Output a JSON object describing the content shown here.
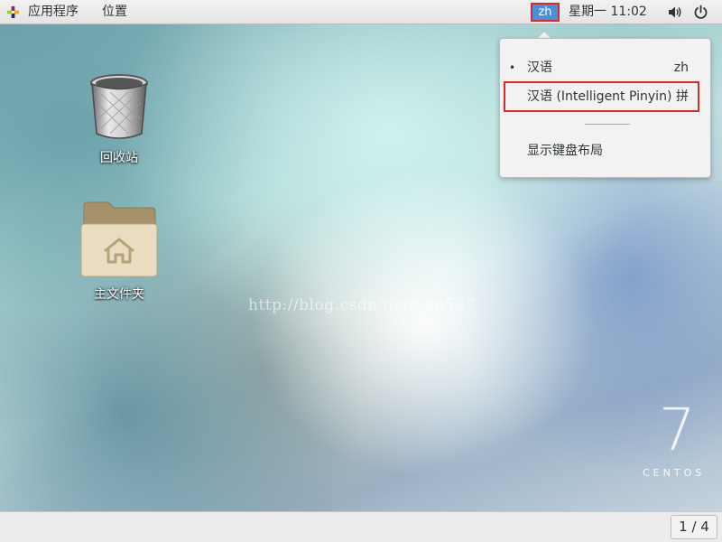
{
  "topbar": {
    "apps_label": "应用程序",
    "places_label": "位置",
    "input_method": "zh",
    "clock": "星期一 11:02",
    "icons": [
      "apps-icon",
      "volume-icon",
      "power-icon"
    ]
  },
  "input_menu": {
    "items": [
      {
        "label": "汉语",
        "short": "zh",
        "selected": true
      },
      {
        "label": "汉语 (Intelligent Pinyin)",
        "short": "拼",
        "selected": false
      }
    ],
    "bullet": "•",
    "show_layout": "显示键盘布局"
  },
  "desktop": {
    "icons": [
      {
        "label": "回收站",
        "icon": "trash-icon"
      },
      {
        "label": "主文件夹",
        "icon": "home-folder-icon"
      }
    ],
    "watermark": "http://blog.csdn.net/xun527",
    "logo_number": "7",
    "logo_text": "CENTOS"
  },
  "bottombar": {
    "workspace": "1 / 4"
  },
  "colors": {
    "accent": "#4a90d9",
    "annotation_red": "#d72b2b"
  }
}
